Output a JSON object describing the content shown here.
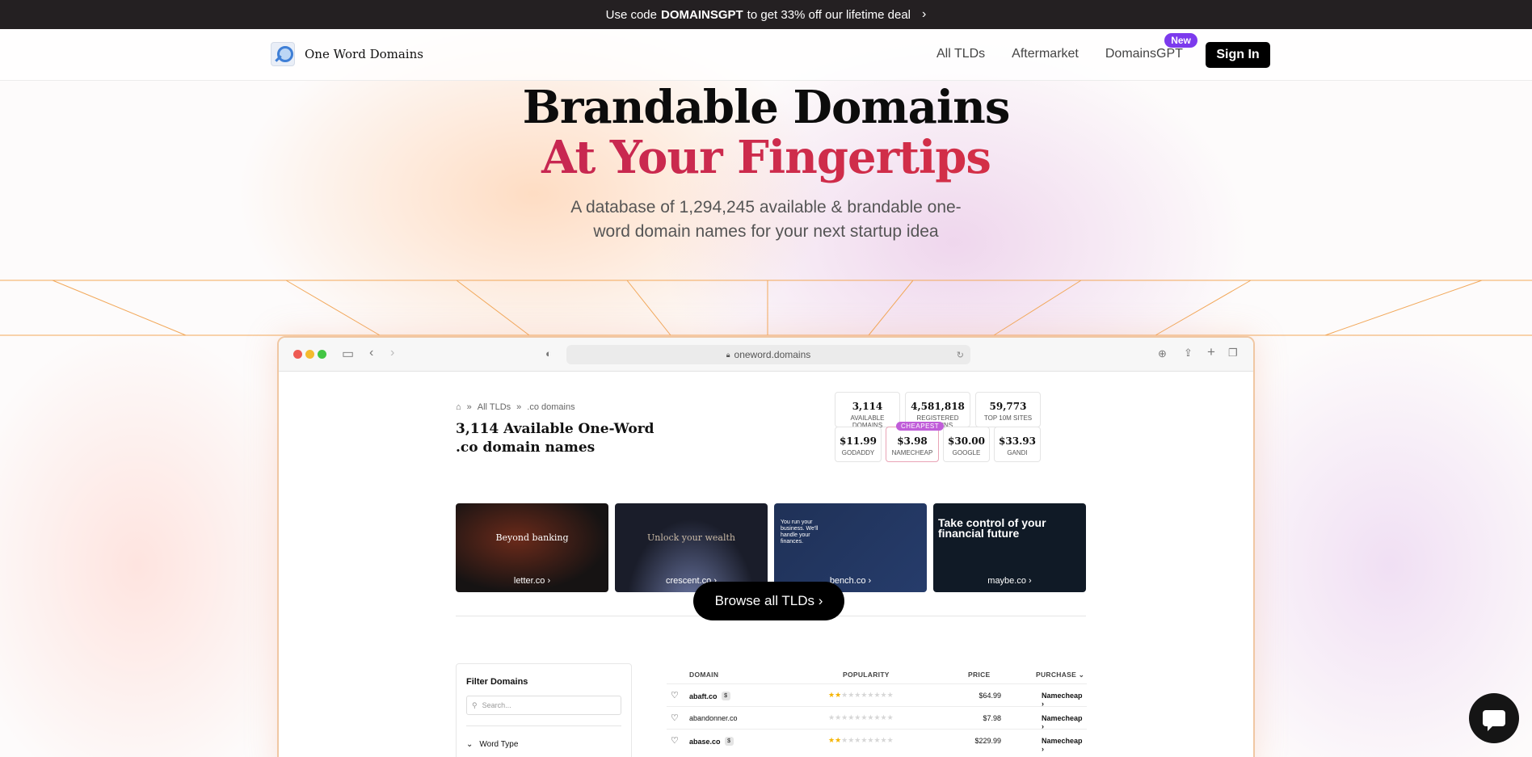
{
  "promo": {
    "prefix": "Use code",
    "code": "DOMAINSGPT",
    "suffix": "to get 33% off our lifetime deal",
    "chevron": "›"
  },
  "nav": {
    "brand": "One Word Domains",
    "links": [
      "All TLDs",
      "Aftermarket",
      "DomainsGPT"
    ],
    "new_badge": "New",
    "signin": "Sign In"
  },
  "hero": {
    "title_line1": "Brandable Domains",
    "title_line2": "At Your Fingertips",
    "subtitle": "A database of 1,294,245 available & brandable one-word domain names for your next startup idea"
  },
  "browser": {
    "url": "oneword.domains",
    "breadcrumb": [
      "All TLDs",
      ".co domains"
    ],
    "page_title": "3,114 Available One-Word .co domain names",
    "stats": [
      {
        "value": "3,114",
        "label": "Available domains"
      },
      {
        "value": "4,581,818",
        "label": "Registered domains"
      },
      {
        "value": "59,773",
        "label": "Top 10M sites"
      }
    ],
    "prices": [
      {
        "value": "$11.99",
        "label": "GoDaddy"
      },
      {
        "value": "$3.98",
        "label": "Namecheap"
      },
      {
        "value": "$30.00",
        "label": "Google"
      },
      {
        "value": "$33.93",
        "label": "Gandi"
      }
    ],
    "cheapest_badge": "CHEAPEST",
    "showcase": [
      {
        "caption": "letter.co ›",
        "headline": "Beyond banking"
      },
      {
        "caption": "crescent.co ›",
        "headline": "Unlock your wealth"
      },
      {
        "caption": "bench.co ›",
        "headline": "You run your business. We'll handle your finances."
      },
      {
        "caption": "maybe.co ›",
        "headline": "Take control of your financial future"
      }
    ],
    "browse_button": "Browse all TLDs ›",
    "filter": {
      "title": "Filter Domains",
      "search_placeholder": "Search...",
      "word_type": "Word Type"
    },
    "table": {
      "headers": [
        "DOMAIN",
        "POPULARITY",
        "PRICE",
        "PURCHASE"
      ],
      "rows": [
        {
          "domain": "abaft.co",
          "premium": true,
          "stars": 2,
          "price": "$64.99",
          "registrar": "Namecheap ›"
        },
        {
          "domain": "abandonner.co",
          "premium": false,
          "stars": 0,
          "price": "$7.98",
          "registrar": "Namecheap ›"
        },
        {
          "domain": "abase.co",
          "premium": true,
          "stars": 2,
          "price": "$229.99",
          "registrar": "Namecheap ›"
        }
      ]
    }
  }
}
